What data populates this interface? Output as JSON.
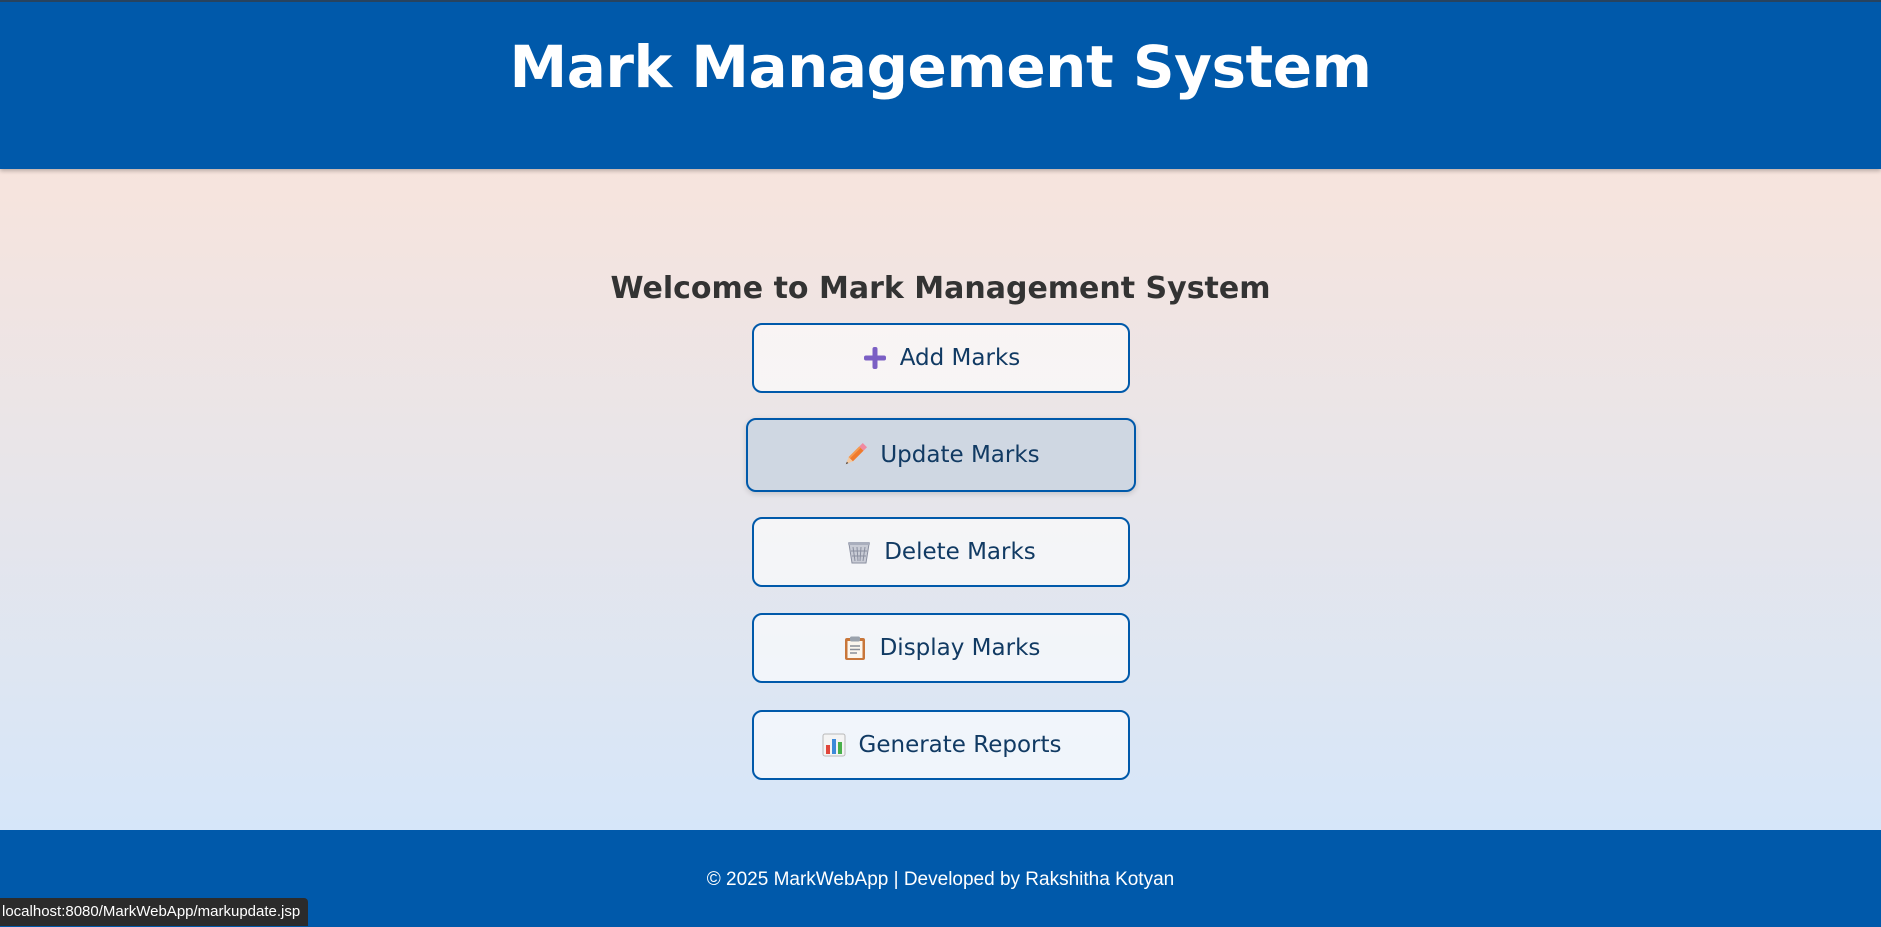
{
  "header": {
    "title": "Mark Management System"
  },
  "main": {
    "welcome": "Welcome to Mark Management System",
    "buttons": [
      {
        "label": "Add Marks",
        "icon": "plus-icon"
      },
      {
        "label": "Update Marks",
        "icon": "pencil-icon"
      },
      {
        "label": "Delete Marks",
        "icon": "wastebasket-icon"
      },
      {
        "label": "Display Marks",
        "icon": "clipboard-icon"
      },
      {
        "label": "Generate Reports",
        "icon": "bar-chart-icon"
      }
    ]
  },
  "footer": {
    "text": "© 2025 MarkWebApp | Developed by Rakshitha Kotyan"
  },
  "status_bar": {
    "url": "localhost:8080/MarkWebApp/markupdate.jsp"
  },
  "colors": {
    "primary": "#0059aa",
    "button_text": "#113a63",
    "hover_bg": "#cfd7e2"
  }
}
